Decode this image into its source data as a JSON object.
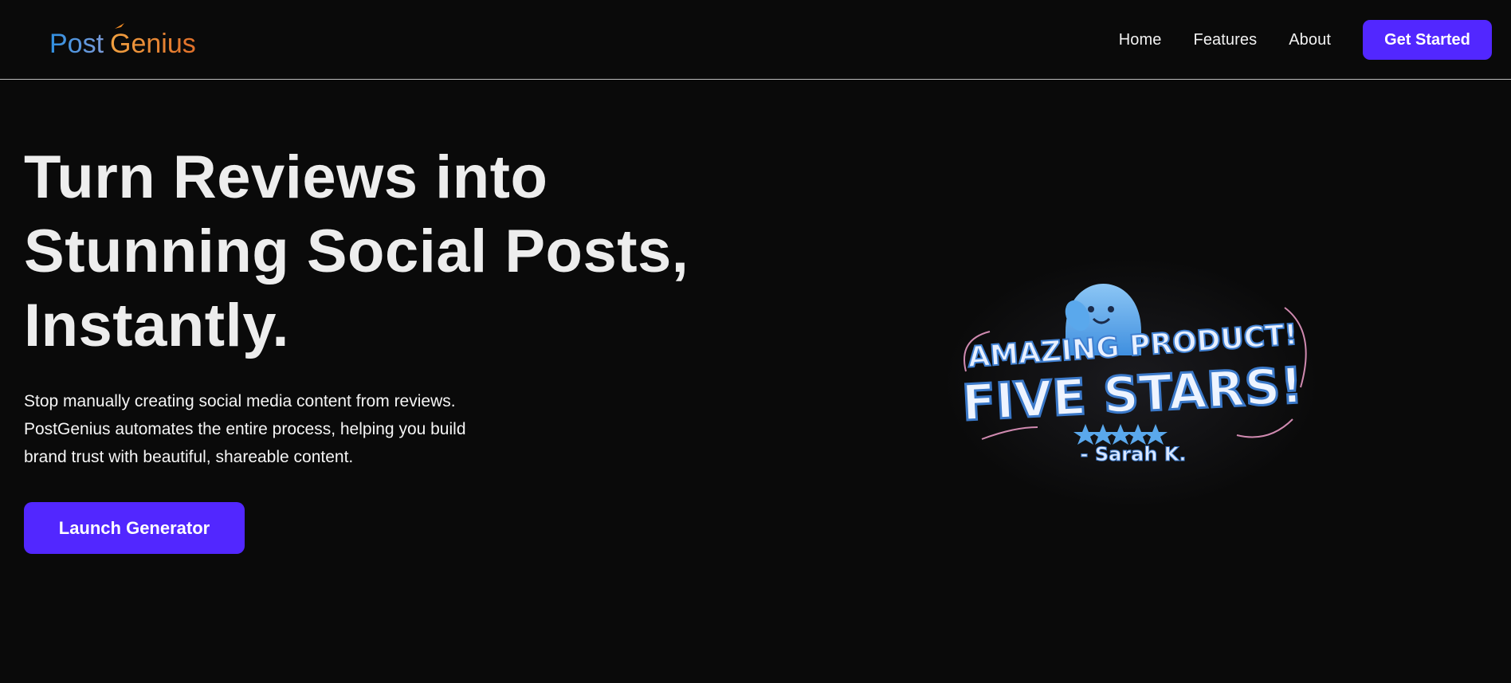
{
  "brand": {
    "name_part1": "Post",
    "name_part2": "Genius"
  },
  "nav": {
    "links": [
      "Home",
      "Features",
      "About"
    ],
    "cta_label": "Get Started"
  },
  "hero": {
    "title_lines": [
      "Turn Reviews into",
      "Stunning Social Posts,",
      "Instantly."
    ],
    "description_lines": [
      "Stop manually creating social media content from reviews.",
      "PostGenius automates the entire process, helping you build",
      "brand trust with beautiful, shareable content."
    ],
    "launch_label": "Launch Generator"
  },
  "illustration": {
    "line1": "AMAZING PRODUCT!",
    "line2": "FIVE STARS!",
    "author": "- Sarah K.",
    "rating": 5,
    "rating_max": 5
  },
  "colors": {
    "accent": "#5227ff",
    "background": "#0a0a0a",
    "logo_blue": "#2f8fe0",
    "logo_orange": "#f08a24",
    "illustration_blue": "#5aa8ec"
  }
}
